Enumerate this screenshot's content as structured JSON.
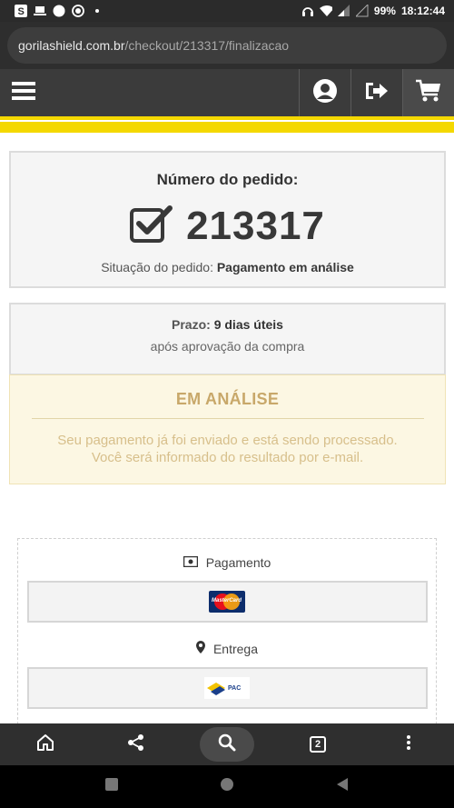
{
  "statusbar": {
    "battery": "99%",
    "time": "18:12:44"
  },
  "browser": {
    "url_host": "gorilashield.com.br",
    "url_path": "/checkout/213317/finalizacao",
    "tab_count": "2"
  },
  "order": {
    "title": "Número do pedido:",
    "number": "213317",
    "status_label": "Situação do pedido:",
    "status_value": "Pagamento em análise"
  },
  "prazo": {
    "label": "Prazo:",
    "value": "9 dias úteis",
    "note": "após aprovação da compra"
  },
  "alert": {
    "title": "EM ANÁLISE",
    "line1": "Seu pagamento já foi enviado e está sendo processado.",
    "line2": "Você será informado do resultado por e-mail."
  },
  "methods": {
    "payment_label": "Pagamento",
    "delivery_label": "Entrega",
    "payment_brand_text": "MasterCard",
    "delivery_brand_text": "PAC"
  },
  "colors": {
    "accent_yellow": "#f4d800",
    "header_dark": "#3b3b3b",
    "alert_text": "#c8a86a"
  }
}
